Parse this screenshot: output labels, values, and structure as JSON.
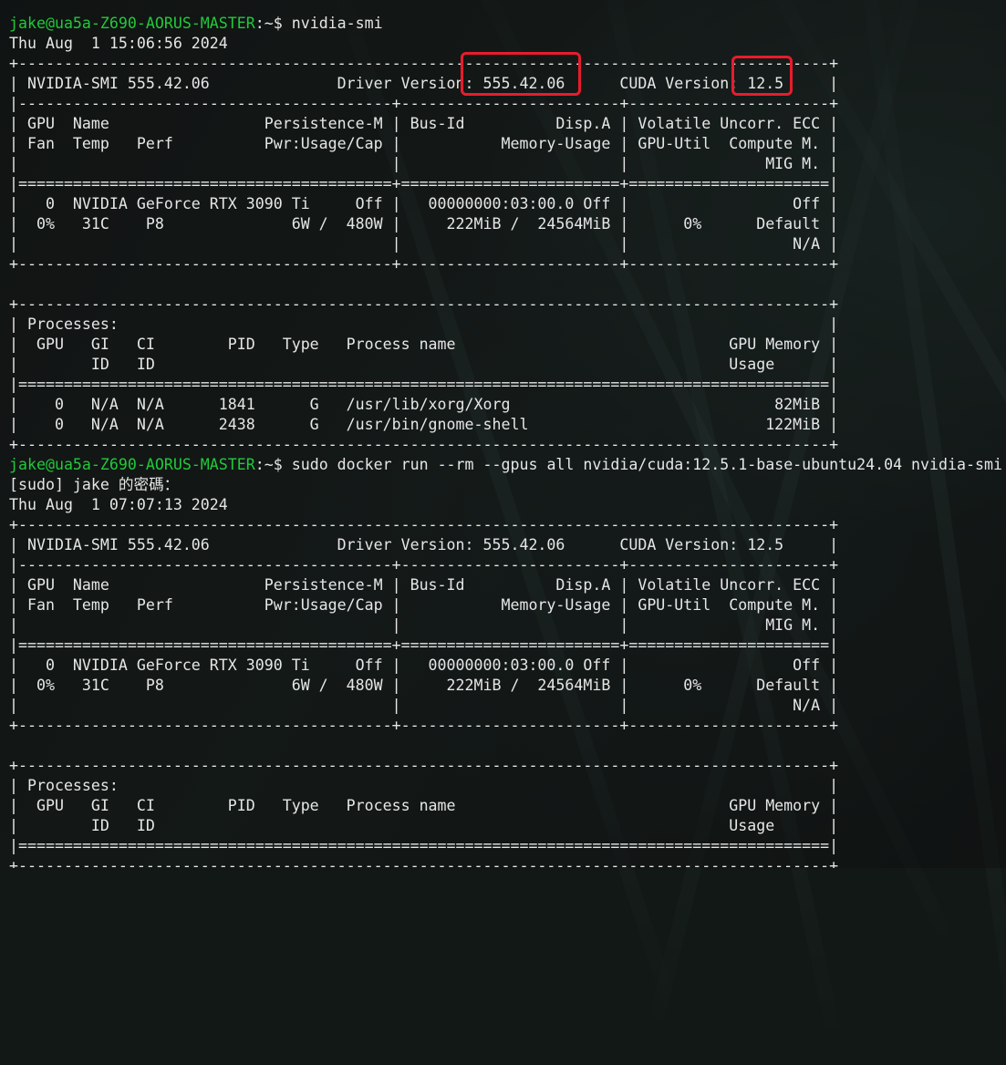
{
  "terminal": {
    "lines": [
      {
        "kind": "text",
        "text": "                   "
      },
      {
        "kind": "prompt",
        "host": "jake@ua5a-Z690-AORUS-MASTER",
        "path": ":~$ ",
        "command": "nvidia-smi"
      },
      {
        "kind": "text",
        "text": "Thu Aug  1 15:06:56 2024"
      },
      {
        "kind": "text",
        "text": "+-----------------------------------------------------------------------------------------+"
      },
      {
        "kind": "text",
        "text": "| NVIDIA-SMI 555.42.06              Driver Version: 555.42.06      CUDA Version: 12.5     |"
      },
      {
        "kind": "text",
        "text": "|-----------------------------------------+------------------------+----------------------+"
      },
      {
        "kind": "text",
        "text": "| GPU  Name                 Persistence-M | Bus-Id          Disp.A | Volatile Uncorr. ECC |"
      },
      {
        "kind": "text",
        "text": "| Fan  Temp   Perf          Pwr:Usage/Cap |           Memory-Usage | GPU-Util  Compute M. |"
      },
      {
        "kind": "text",
        "text": "|                                         |                        |               MIG M. |"
      },
      {
        "kind": "text",
        "text": "|=========================================+========================+======================|"
      },
      {
        "kind": "text",
        "text": "|   0  NVIDIA GeForce RTX 3090 Ti     Off |   00000000:03:00.0 Off |                  Off |"
      },
      {
        "kind": "text",
        "text": "|  0%   31C    P8              6W /  480W |     222MiB /  24564MiB |      0%      Default |"
      },
      {
        "kind": "text",
        "text": "|                                         |                        |                  N/A |"
      },
      {
        "kind": "text",
        "text": "+-----------------------------------------+------------------------+----------------------+"
      },
      {
        "kind": "text",
        "text": " "
      },
      {
        "kind": "text",
        "text": "+-----------------------------------------------------------------------------------------+"
      },
      {
        "kind": "text",
        "text": "| Processes:                                                                              |"
      },
      {
        "kind": "text",
        "text": "|  GPU   GI   CI        PID   Type   Process name                              GPU Memory |"
      },
      {
        "kind": "text",
        "text": "|        ID   ID                                                               Usage      |"
      },
      {
        "kind": "text",
        "text": "|=========================================================================================|"
      },
      {
        "kind": "text",
        "text": "|    0   N/A  N/A      1841      G   /usr/lib/xorg/Xorg                             82MiB |"
      },
      {
        "kind": "text",
        "text": "|    0   N/A  N/A      2438      G   /usr/bin/gnome-shell                          122MiB |"
      },
      {
        "kind": "text",
        "text": "+-----------------------------------------------------------------------------------------+"
      },
      {
        "kind": "prompt",
        "host": "jake@ua5a-Z690-AORUS-MASTER",
        "path": ":~$ ",
        "command": "sudo docker run --rm --gpus all nvidia/cuda:12.5.1-base-ubuntu24.04 nvidia-smi"
      },
      {
        "kind": "text",
        "text": "[sudo] jake 的密碼："
      },
      {
        "kind": "text",
        "text": "Thu Aug  1 07:07:13 2024"
      },
      {
        "kind": "text",
        "text": "+-----------------------------------------------------------------------------------------+"
      },
      {
        "kind": "text",
        "text": "| NVIDIA-SMI 555.42.06              Driver Version: 555.42.06      CUDA Version: 12.5     |"
      },
      {
        "kind": "text",
        "text": "|-----------------------------------------+------------------------+----------------------+"
      },
      {
        "kind": "text",
        "text": "| GPU  Name                 Persistence-M | Bus-Id          Disp.A | Volatile Uncorr. ECC |"
      },
      {
        "kind": "text",
        "text": "| Fan  Temp   Perf          Pwr:Usage/Cap |           Memory-Usage | GPU-Util  Compute M. |"
      },
      {
        "kind": "text",
        "text": "|                                         |                        |               MIG M. |"
      },
      {
        "kind": "text",
        "text": "|=========================================+========================+======================|"
      },
      {
        "kind": "text",
        "text": "|   0  NVIDIA GeForce RTX 3090 Ti     Off |   00000000:03:00.0 Off |                  Off |"
      },
      {
        "kind": "text",
        "text": "|  0%   31C    P8              6W /  480W |     222MiB /  24564MiB |      0%      Default |"
      },
      {
        "kind": "text",
        "text": "|                                         |                        |                  N/A |"
      },
      {
        "kind": "text",
        "text": "+-----------------------------------------+------------------------+----------------------+"
      },
      {
        "kind": "text",
        "text": " "
      },
      {
        "kind": "text",
        "text": "+-----------------------------------------------------------------------------------------+"
      },
      {
        "kind": "text",
        "text": "| Processes:                                                                              |"
      },
      {
        "kind": "text",
        "text": "|  GPU   GI   CI        PID   Type   Process name                              GPU Memory |"
      },
      {
        "kind": "text",
        "text": "|        ID   ID                                                               Usage      |"
      },
      {
        "kind": "text",
        "text": "|=========================================================================================|"
      },
      {
        "kind": "text",
        "text": "+-----------------------------------------------------------------------------------------+"
      }
    ]
  },
  "annotations": {
    "color": "#e81c2d",
    "boxes": [
      "driver-version-highlight",
      "cuda-version-highlight"
    ]
  }
}
